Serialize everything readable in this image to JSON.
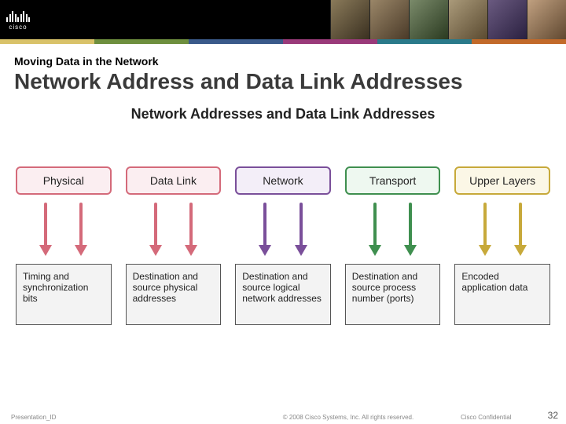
{
  "brand": {
    "name": "cisco"
  },
  "slide": {
    "eyebrow": "Moving Data in the Network",
    "title": "Network Address and Data Link Addresses",
    "content_title": "Network Addresses and Data Link Addresses"
  },
  "layers": [
    {
      "label": "Physical",
      "color": "#d46a7a",
      "bg": "#fbeef1",
      "desc": "Timing and synchronization bits"
    },
    {
      "label": "Data Link",
      "color": "#d46a7a",
      "bg": "#fbeef1",
      "desc": "Destination and source physical addresses"
    },
    {
      "label": "Network",
      "color": "#7a4f9a",
      "bg": "#f3eef8",
      "desc": "Destination and source logical network addresses"
    },
    {
      "label": "Transport",
      "color": "#3f8f4f",
      "bg": "#eef8f0",
      "desc": "Destination and source process number (ports)"
    },
    {
      "label": "Upper Layers",
      "color": "#c7a93a",
      "bg": "#fbf7e6",
      "desc": "Encoded application data"
    }
  ],
  "footer": {
    "left": "Presentation_ID",
    "mid": "© 2008 Cisco Systems, Inc. All rights reserved.",
    "right": "Cisco Confidential",
    "page": "32"
  }
}
